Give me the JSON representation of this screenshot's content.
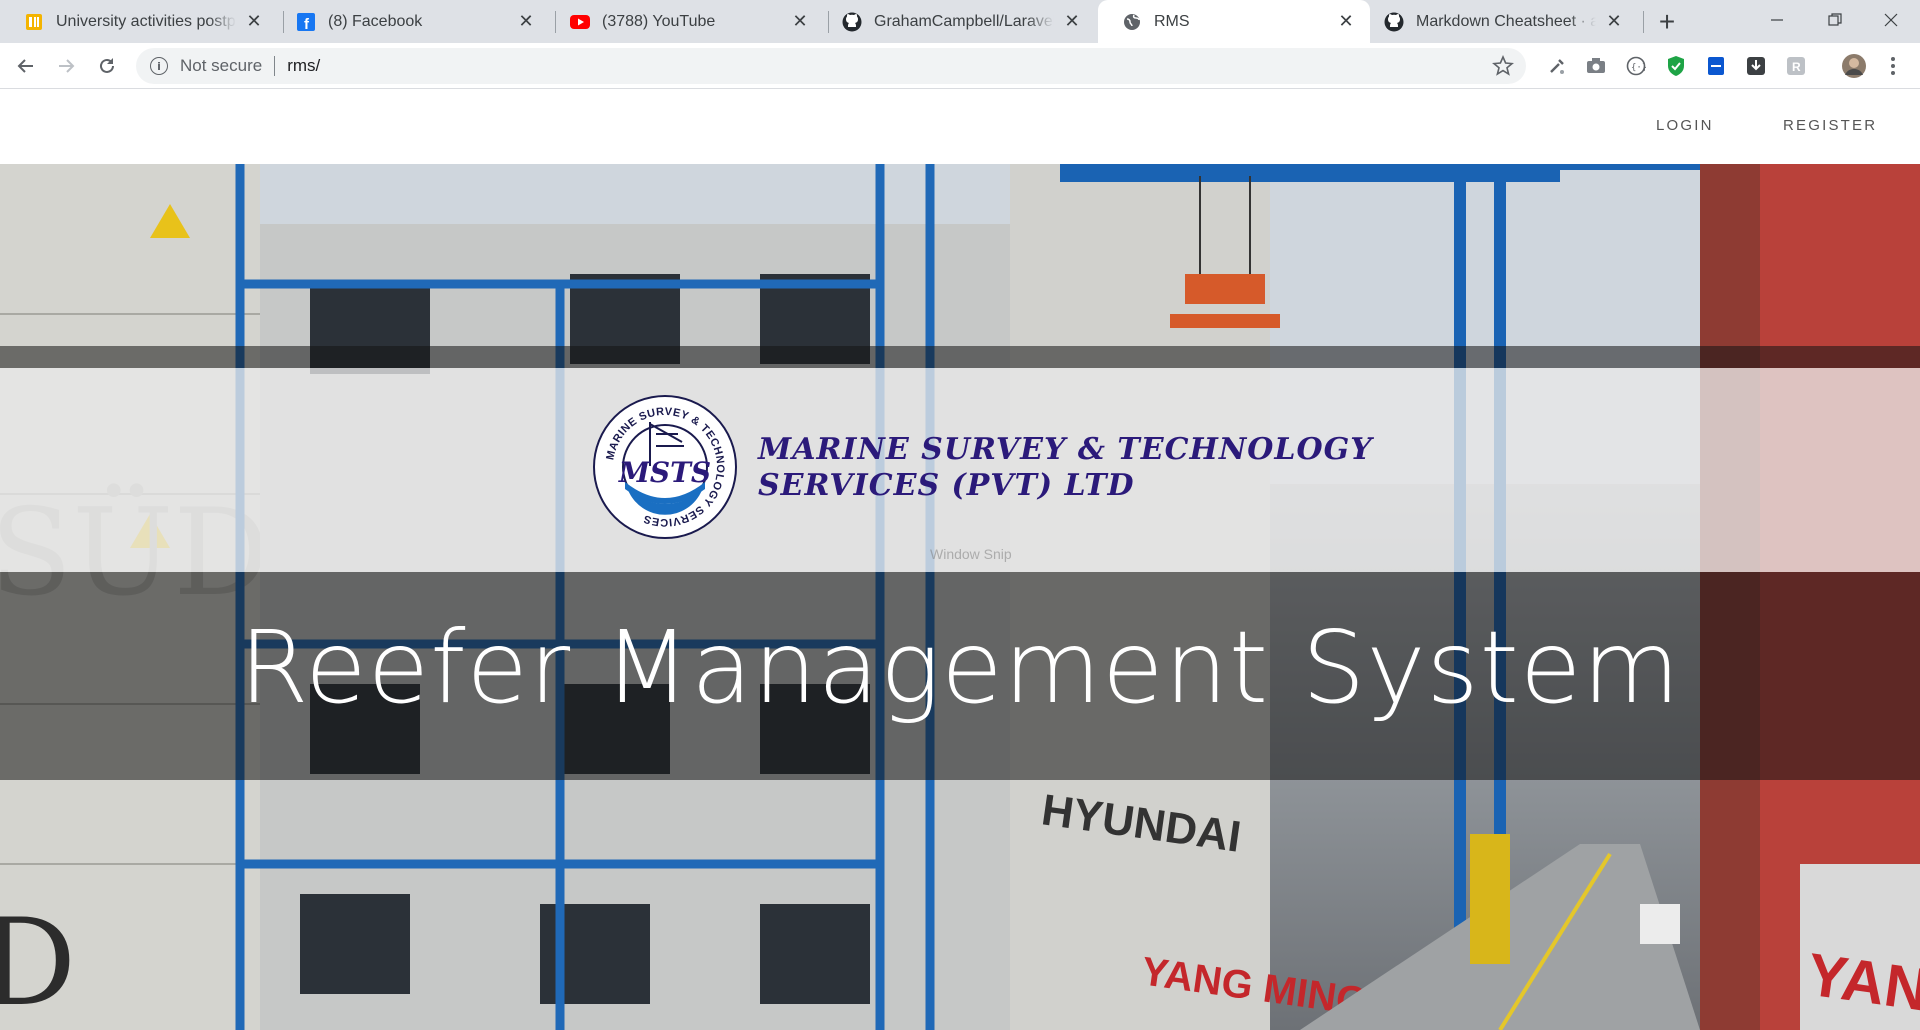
{
  "browser": {
    "tabs": [
      {
        "title": "University activities postponed",
        "icon": "document-icon",
        "active": false
      },
      {
        "title": "(8) Facebook",
        "icon": "facebook-icon",
        "active": false
      },
      {
        "title": "(3788) YouTube",
        "icon": "youtube-icon",
        "active": false
      },
      {
        "title": "GrahamCampbell/Laravel-Markdown",
        "icon": "github-icon",
        "active": false
      },
      {
        "title": "RMS",
        "icon": "globe-icon",
        "active": true
      },
      {
        "title": "Markdown Cheatsheet · adam-p",
        "icon": "github-icon",
        "active": false
      }
    ],
    "address": {
      "security_label": "Not secure",
      "url": "rms/"
    },
    "colors": {
      "tabstrip": "#dee1e6",
      "omnibox": "#f1f3f4"
    }
  },
  "nav": {
    "login": "LOGIN",
    "register": "REGISTER"
  },
  "hero": {
    "company_line1": "MARINE SURVEY & TECHNOLOGY",
    "company_line2": "SERVICES (PVT) LTD",
    "logo_ring_text": "MARINE SURVEY & TECHNOLOGY SERVICES",
    "logo_monogram": "MSTS",
    "headline": "Reefer Management System",
    "watermark": "Window Snip",
    "colors": {
      "brand": "#2b1a7a",
      "logo_blue": "#1a6fc2"
    }
  }
}
